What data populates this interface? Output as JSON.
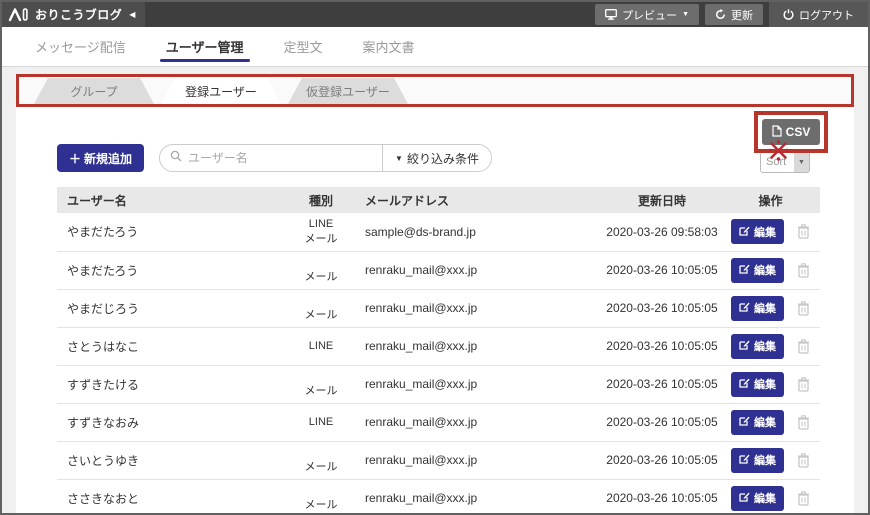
{
  "header": {
    "logo_text": "おりこうブログ",
    "logo_collapse": "◀",
    "preview_button": "プレビュー",
    "refresh_button": "更新",
    "logout_button": "ログアウト"
  },
  "nav": {
    "items": [
      {
        "label": "メッセージ配信",
        "active": false
      },
      {
        "label": "ユーザー管理",
        "active": true
      },
      {
        "label": "定型文",
        "active": false
      },
      {
        "label": "案内文書",
        "active": false
      }
    ]
  },
  "tabs": {
    "items": [
      {
        "label": "グループ",
        "active": false
      },
      {
        "label": "登録ユーザー",
        "active": true
      },
      {
        "label": "仮登録ユーザー",
        "active": false
      }
    ]
  },
  "toolbar": {
    "add_button": "新規追加",
    "add_plus": "＋",
    "search_placeholder": "ユーザー名",
    "filter_button": "絞り込み条件",
    "csv_button": "CSV",
    "sort_select_value": "Sort",
    "note_mark": "※"
  },
  "table": {
    "headers": [
      "ユーザー名",
      "種別",
      "メールアドレス",
      "更新日時",
      "操作"
    ],
    "edit_button": "編集",
    "rows": [
      {
        "name": "やまだたろう",
        "type_lines": [
          "LINE",
          "メール"
        ],
        "email": "sample@ds-brand.jp",
        "updated": "2020-03-26 09:58:03"
      },
      {
        "name": "やまだたろう",
        "type_lines": [
          "",
          "メール"
        ],
        "email": "renraku_mail@xxx.jp",
        "updated": "2020-03-26 10:05:05"
      },
      {
        "name": "やまだじろう",
        "type_lines": [
          "",
          "メール"
        ],
        "email": "renraku_mail@xxx.jp",
        "updated": "2020-03-26 10:05:05"
      },
      {
        "name": "さとうはなこ",
        "type_lines": [
          "LINE"
        ],
        "email": "renraku_mail@xxx.jp",
        "updated": "2020-03-26 10:05:05"
      },
      {
        "name": "すずきたける",
        "type_lines": [
          "",
          "メール"
        ],
        "email": "renraku_mail@xxx.jp",
        "updated": "2020-03-26 10:05:05"
      },
      {
        "name": "すずきなおみ",
        "type_lines": [
          "LINE"
        ],
        "email": "renraku_mail@xxx.jp",
        "updated": "2020-03-26 10:05:05"
      },
      {
        "name": "さいとうゆき",
        "type_lines": [
          "",
          "メール"
        ],
        "email": "renraku_mail@xxx.jp",
        "updated": "2020-03-26 10:05:05"
      },
      {
        "name": "ささきなおと",
        "type_lines": [
          "",
          "メール"
        ],
        "email": "renraku_mail@xxx.jp",
        "updated": "2020-03-26 10:05:05"
      }
    ]
  },
  "colors": {
    "brand_navy": "#2e3192",
    "highlight_red": "#b7362b",
    "topbar_gray": "#3e3e3e",
    "button_gray": "#6d6d6d"
  }
}
